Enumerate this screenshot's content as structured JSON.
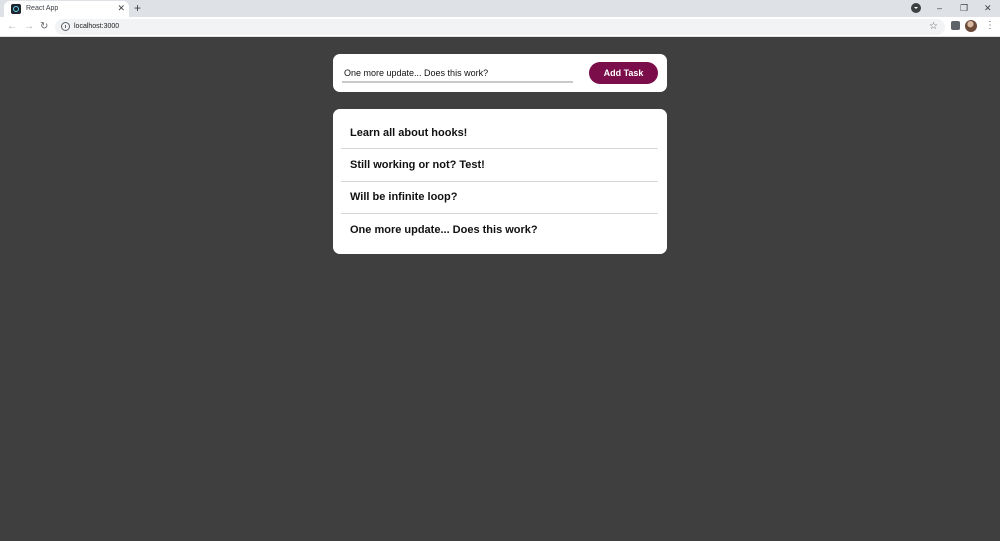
{
  "browser": {
    "tab_title": "React App",
    "tab_close": "✕",
    "new_tab": "+",
    "url": "localhost:3000",
    "window_min": "–",
    "window_max": "❐",
    "window_close": "✕"
  },
  "form": {
    "input_value": "One more update... Does this work?",
    "add_button_label": "Add Task"
  },
  "tasks": [
    "Learn all about hooks!",
    "Still working or not? Test!",
    "Will be infinite loop?",
    "One more update... Does this work?"
  ],
  "colors": {
    "page_background": "#3f3f3f",
    "accent": "#7b0d4a",
    "card": "#ffffff"
  }
}
